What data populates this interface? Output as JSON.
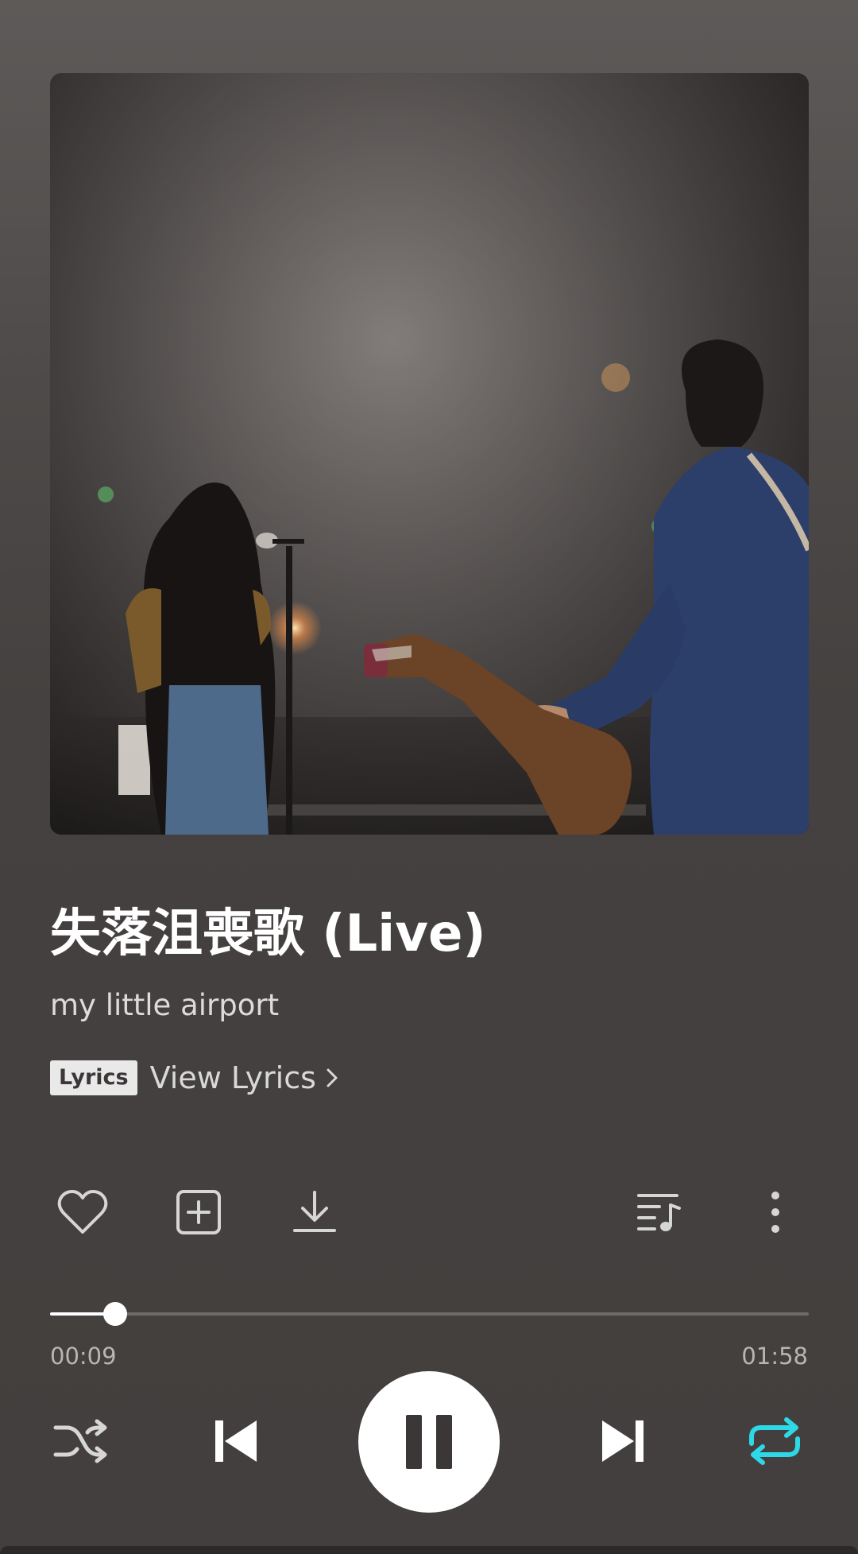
{
  "song": {
    "title": "失落沮喪歌 (Live)",
    "artist": "my little airport"
  },
  "lyrics": {
    "badge": "Lyrics",
    "link_label": "View Lyrics"
  },
  "actions": {
    "like_icon": "heart-icon",
    "add_icon": "add-to-playlist-icon",
    "download_icon": "download-icon",
    "queue_icon": "playlist-queue-icon",
    "more_icon": "more-vertical-icon"
  },
  "progress": {
    "current_time": "00:09",
    "total_time": "01:58",
    "fraction": 0.0862
  },
  "controls": {
    "shuffle_icon": "shuffle-icon",
    "previous_icon": "skip-previous-icon",
    "play_state": "playing",
    "pause_icon": "pause-icon",
    "next_icon": "skip-next-icon",
    "repeat_icon": "repeat-icon",
    "repeat_active_color": "#2fd8e6"
  },
  "colors": {
    "background": "#433f3e",
    "accent": "#2fd8e6"
  }
}
